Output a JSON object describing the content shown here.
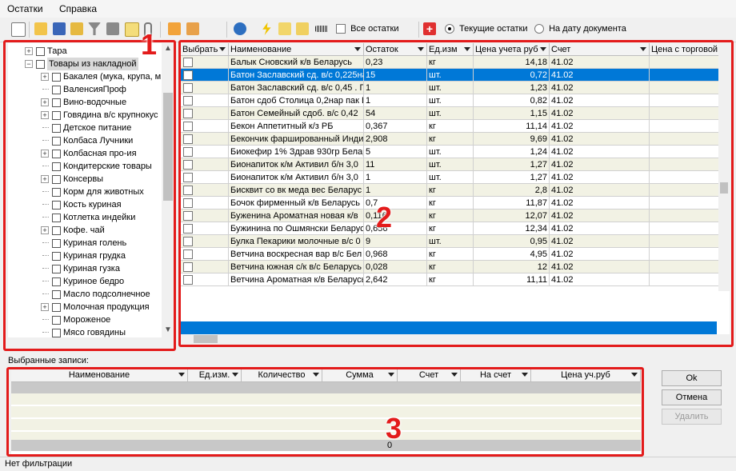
{
  "menu": [
    "Остатки",
    "Справка"
  ],
  "toolbar": {
    "all_remains_label": "Все остатки",
    "current_remains_label": "Текущие остатки",
    "by_date_label": "На дату документа"
  },
  "tree": [
    {
      "label": "Тара",
      "expander": "+",
      "level": 0
    },
    {
      "label": "Товары из накладной",
      "expander": "-",
      "level": 0,
      "selected": true
    },
    {
      "label": "Бакалея (мука, крупа, м",
      "expander": "+",
      "level": 1
    },
    {
      "label": "ВаленсияПроф",
      "expander": "",
      "level": 1
    },
    {
      "label": "Вино-водочные",
      "expander": "+",
      "level": 1
    },
    {
      "label": "Говядина в/с крупнокус",
      "expander": "+",
      "level": 1
    },
    {
      "label": "Детское питание",
      "expander": "",
      "level": 1
    },
    {
      "label": "Колбаса Лучники",
      "expander": "",
      "level": 1
    },
    {
      "label": "Колбасная про-ия",
      "expander": "+",
      "level": 1
    },
    {
      "label": "Кондитерские товары",
      "expander": "",
      "level": 1
    },
    {
      "label": "Консервы",
      "expander": "+",
      "level": 1
    },
    {
      "label": "Корм для животных",
      "expander": "",
      "level": 1
    },
    {
      "label": "Кость куриная",
      "expander": "",
      "level": 1
    },
    {
      "label": "Котлетка индейки",
      "expander": "",
      "level": 1
    },
    {
      "label": "Кофе. чай",
      "expander": "+",
      "level": 1
    },
    {
      "label": "Куриная голень",
      "expander": "",
      "level": 1
    },
    {
      "label": "Куриная грудка",
      "expander": "",
      "level": 1
    },
    {
      "label": "Куриная гузка",
      "expander": "",
      "level": 1
    },
    {
      "label": "Куриное бедро",
      "expander": "",
      "level": 1
    },
    {
      "label": "Масло подсолнечное",
      "expander": "",
      "level": 1
    },
    {
      "label": "Молочная продукция",
      "expander": "+",
      "level": 1
    },
    {
      "label": "Мороженое",
      "expander": "",
      "level": 1
    },
    {
      "label": "Мясо говядины",
      "expander": "",
      "level": 1
    }
  ],
  "grid": {
    "columns": [
      "Выбрать",
      "Наименование",
      "Остаток",
      "Ед.изм",
      "Цена учета руб",
      "Счет",
      "Цена с торговой"
    ],
    "rows": [
      {
        "name": "Балык Сновский к/в Беларусь",
        "rest": "0,23",
        "unit": "кг",
        "price": "14,18",
        "account": "41.02"
      },
      {
        "name": "Батон Заславский сд. в/с 0,225на",
        "rest": "15",
        "unit": "шт.",
        "price": "0,72",
        "account": "41.02",
        "selected": true
      },
      {
        "name": "Батон Заславский сд. в/с 0,45 . П",
        "rest": "1",
        "unit": "шт.",
        "price": "1,23",
        "account": "41.02"
      },
      {
        "name": "Батон сдоб Столица 0,2нар пак Б",
        "rest": "1",
        "unit": "шт.",
        "price": "0,82",
        "account": "41.02"
      },
      {
        "name": "Батон Семейный сдоб. в/с 0,42",
        "rest": "54",
        "unit": "шт.",
        "price": "1,15",
        "account": "41.02"
      },
      {
        "name": "Бекон Аппетитный к/з РБ",
        "rest": "0,367",
        "unit": "кг",
        "price": "11,14",
        "account": "41.02"
      },
      {
        "name": "Бекончик фаршированный Инди",
        "rest": "2,908",
        "unit": "кг",
        "price": "9,69",
        "account": "41.02"
      },
      {
        "name": "Биокефир 1% Здрав 930гр Белар",
        "rest": "5",
        "unit": "шт.",
        "price": "1,24",
        "account": "41.02"
      },
      {
        "name": "Бионапиток к/м Активил б/н 3,0",
        "rest": "11",
        "unit": "шт.",
        "price": "1,27",
        "account": "41.02"
      },
      {
        "name": "Бионапиток к/м Активил б/н 3,0",
        "rest": "1",
        "unit": "шт.",
        "price": "1,27",
        "account": "41.02"
      },
      {
        "name": "Бисквит со  вк меда вес Беларус",
        "rest": "1",
        "unit": "кг",
        "price": "2,8",
        "account": "41.02"
      },
      {
        "name": "Бочок фирменный к/в Беларусь",
        "rest": "0,7",
        "unit": "кг",
        "price": "11,87",
        "account": "41.02"
      },
      {
        "name": "Буженина Ароматная новая к/в",
        "rest": "0,116",
        "unit": "кг",
        "price": "12,07",
        "account": "41.02"
      },
      {
        "name": "Бужинина по Ошмянски Беларус",
        "rest": "0,656",
        "unit": "кг",
        "price": "12,34",
        "account": "41.02"
      },
      {
        "name": "Булка Пекарики молочные в/с 0",
        "rest": "9",
        "unit": "шт.",
        "price": "0,95",
        "account": "41.02"
      },
      {
        "name": "Ветчина  воскресная вар в/с Бел",
        "rest": "0,968",
        "unit": "кг",
        "price": "4,95",
        "account": "41.02"
      },
      {
        "name": "Ветчина  южная с/к в/с Беларусь",
        "rest": "0,028",
        "unit": "кг",
        "price": "12",
        "account": "41.02"
      },
      {
        "name": "Ветчина Ароматная к/в Беларусь",
        "rest": "2,642",
        "unit": "кг",
        "price": "11,11",
        "account": "41.02"
      }
    ]
  },
  "selected_records": {
    "label": "Выбранные записи:",
    "columns": [
      "Наименование",
      "Ед.изм.",
      "Количество",
      "Сумма",
      "Счет",
      "На счет",
      "Цена уч.руб"
    ],
    "total_sum": "0"
  },
  "buttons": {
    "ok": "Ok",
    "cancel": "Отмена",
    "delete": "Удалить"
  },
  "status": "Нет фильтрации",
  "badges": [
    "1",
    "2",
    "3"
  ],
  "colors": {
    "selection": "#0078d7",
    "highlight": "#e31b1b",
    "row_alt": "#f2f2e4"
  }
}
